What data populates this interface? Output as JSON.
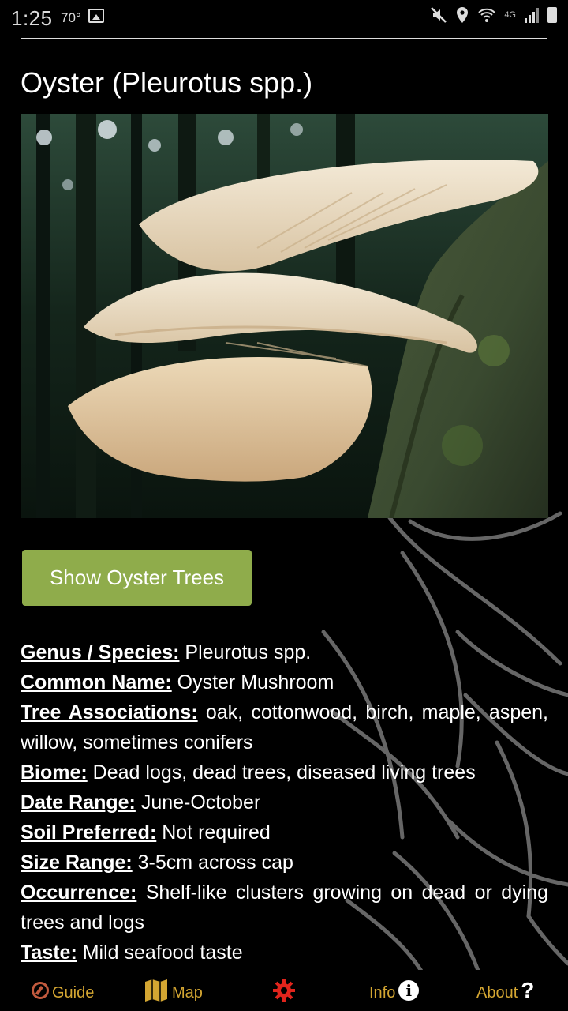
{
  "status_bar": {
    "time": "1:25",
    "temp": "70°",
    "network": "4G"
  },
  "title": "Oyster (Pleurotus spp.)",
  "cta_label": "Show Oyster Trees",
  "details": [
    {
      "label": "Genus / Species:",
      "value": " Pleurotus spp."
    },
    {
      "label": "Common Name:",
      "value": " Oyster Mushroom"
    },
    {
      "label": "Tree Associations:",
      "value": " oak, cottonwood, birch, maple, aspen, willow, sometimes conifers"
    },
    {
      "label": "Biome:",
      "value": " Dead logs, dead trees, diseased living trees"
    },
    {
      "label": "Date Range:",
      "value": " June-October"
    },
    {
      "label": "Soil Preferred:",
      "value": " Not required"
    },
    {
      "label": "Size Range:",
      "value": " 3-5cm across cap"
    },
    {
      "label": "Occurrence:",
      "value": " Shelf-like clusters growing on dead or dying trees and logs"
    },
    {
      "label": "Taste:",
      "value": " Mild seafood taste"
    }
  ],
  "nav": {
    "guide": "Guide",
    "map": "Map",
    "info": "Info",
    "about": "About"
  },
  "colors": {
    "accent_button": "#8fac4b",
    "nav_text": "#d4a632",
    "settings_icon": "#e0241c"
  }
}
